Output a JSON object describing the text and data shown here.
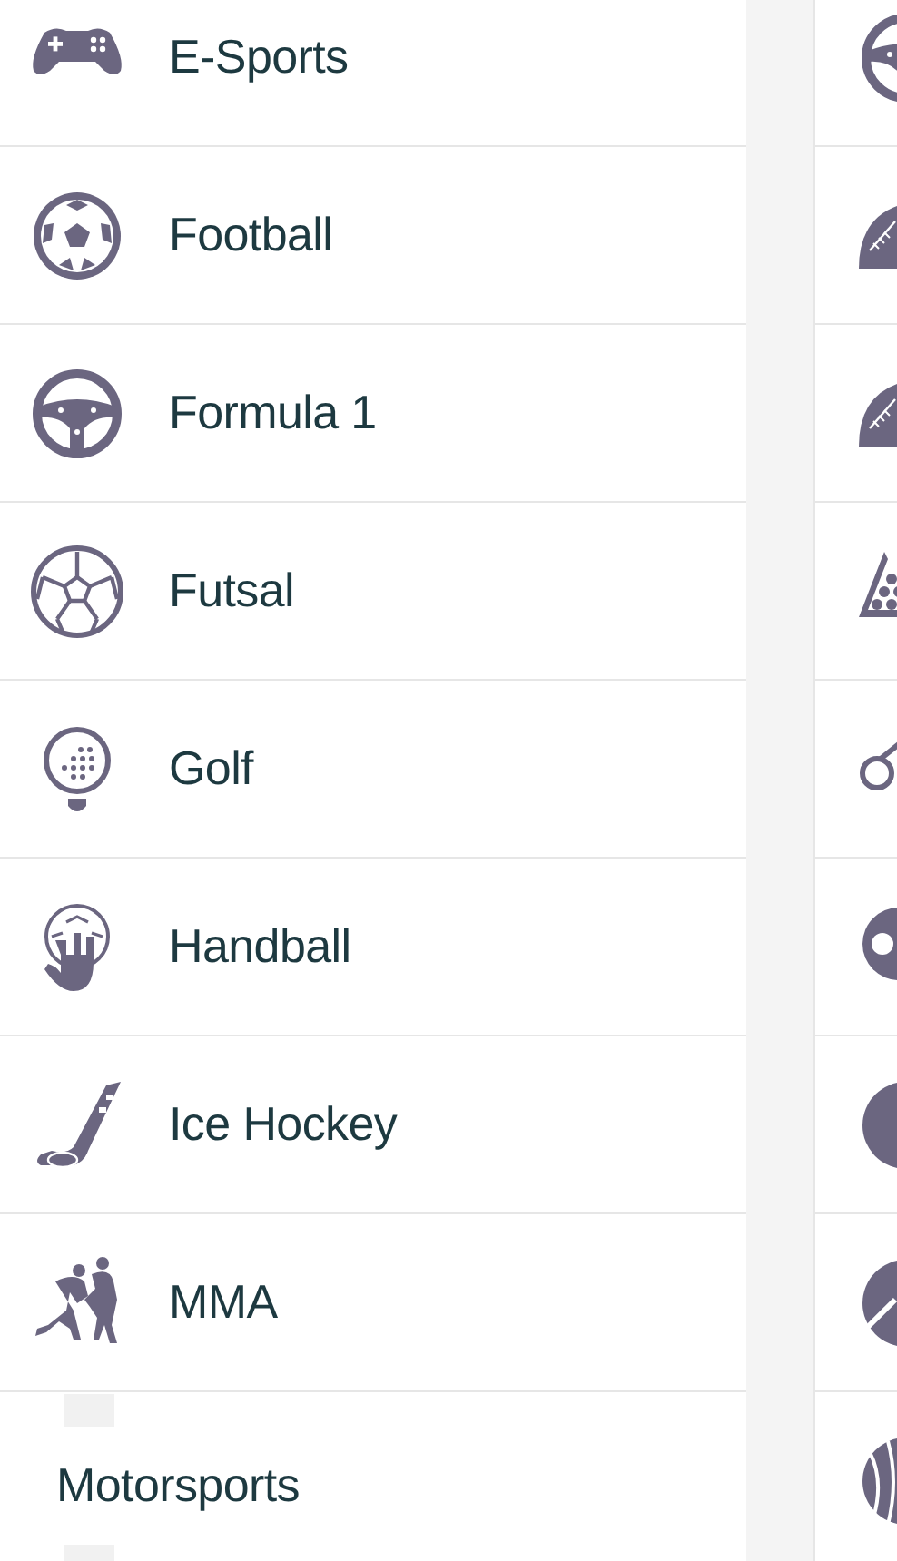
{
  "sports": [
    {
      "kind": "icon",
      "label": "E-Sports"
    },
    {
      "kind": "icon",
      "label": "Football"
    },
    {
      "kind": "icon",
      "label": "Formula 1"
    },
    {
      "kind": "icon",
      "label": "Futsal"
    },
    {
      "kind": "icon",
      "label": "Golf"
    },
    {
      "kind": "icon",
      "label": "Handball"
    },
    {
      "kind": "icon",
      "label": "Ice Hockey"
    },
    {
      "kind": "icon",
      "label": "MMA"
    },
    {
      "kind": "missing-icon",
      "label": "Motorsports"
    }
  ]
}
